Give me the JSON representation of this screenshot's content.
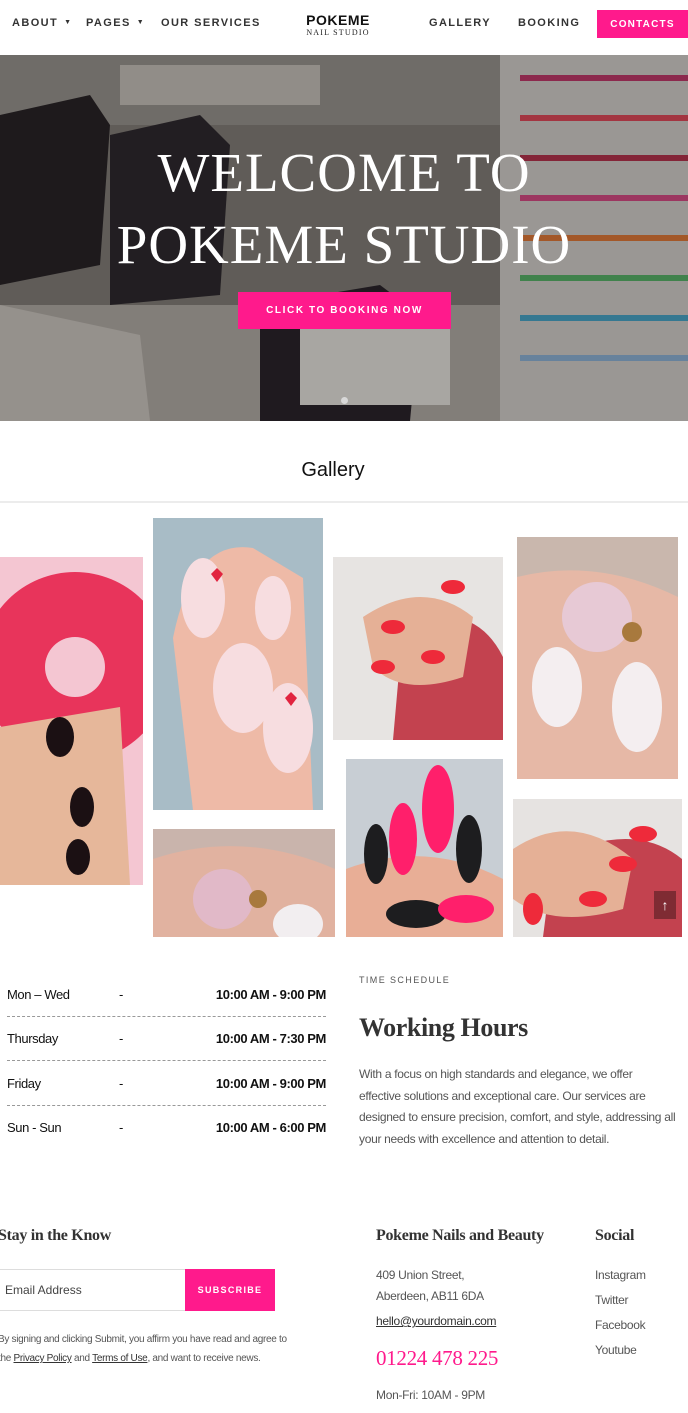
{
  "nav": {
    "about": "ABOUT",
    "pages": "PAGES",
    "services": "OUR SERVICES",
    "gallery": "GALLERY",
    "booking": "BOOKING",
    "contacts": "CONTACTS",
    "logo_main": "POKEME",
    "logo_sub": "NAIL STUDIO"
  },
  "hero": {
    "title_line1": "WELCOME TO",
    "title_line2": "POKEME STUDIO",
    "button": "CLICK TO BOOKING NOW"
  },
  "gallery": {
    "title": "Gallery"
  },
  "hours": [
    {
      "day": "Mon – Wed",
      "dash": "-",
      "time": "10:00 AM - 9:00 PM"
    },
    {
      "day": "Thursday",
      "dash": "-",
      "time": "10:00 AM - 7:30 PM"
    },
    {
      "day": "Friday",
      "dash": "-",
      "time": "10:00 AM - 9:00 PM"
    },
    {
      "day": "Sun - Sun",
      "dash": "-",
      "time": "10:00 AM - 6:00 PM"
    }
  ],
  "schedule": {
    "label": "TIME SCHEDULE",
    "title": "Working Hours",
    "text": "With a focus on high standards and elegance, we offer effective solutions and exceptional care. Our services are designed to ensure precision, comfort, and style, addressing all your needs with excellence and attention to detail."
  },
  "footer": {
    "newsletter_heading": "Stay in the Know",
    "email_placeholder": "Email Address",
    "subscribe": "SUBSCRIBE",
    "legal_pre": "By signing and clicking Submit, you affirm you have read and agree to the",
    "privacy": "Privacy Policy",
    "and": "and",
    "terms": "Terms of Use",
    "legal_post": ", and want to receive news.",
    "company_heading": "Pokeme Nails and Beauty",
    "address_line1": "409 Union Street,",
    "address_line2": "Aberdeen, AB11 6DA",
    "email": "hello@yourdomain.com",
    "phone": "01224 478 225",
    "open_hours": "Mon-Fri: 10AM - 9PM",
    "social_heading": "Social",
    "social": [
      "Instagram",
      "Twitter",
      "Facebook",
      "Youtube"
    ]
  },
  "colors": {
    "accent": "#ff1a8c",
    "text_dark": "#333333"
  }
}
